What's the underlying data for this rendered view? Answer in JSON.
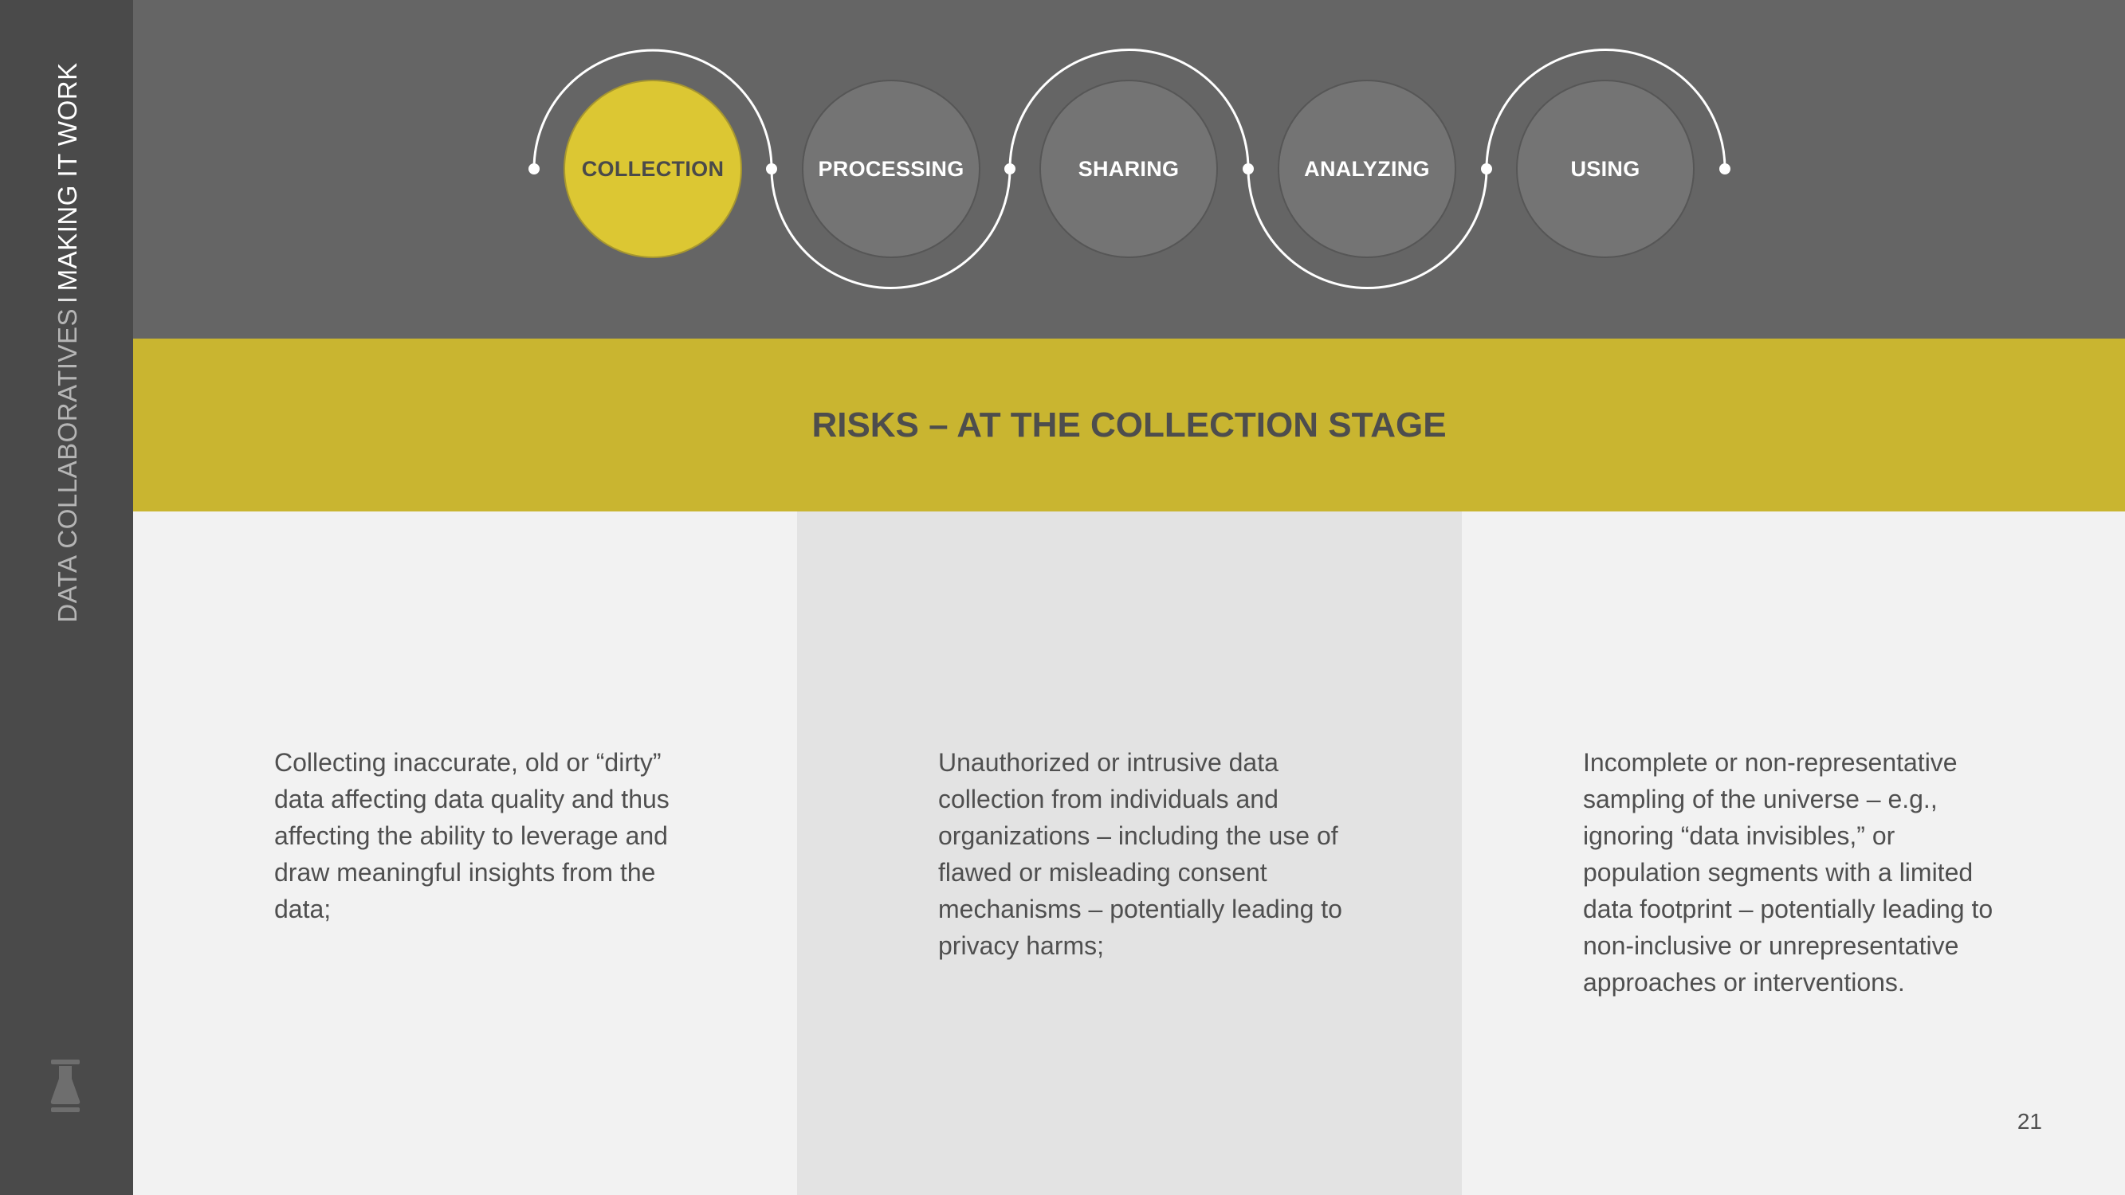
{
  "sidebar": {
    "title_part1": "DATA COLLABORATIVES",
    "separator": "I",
    "title_part2": "MAKING IT WORK",
    "logo_icon": "flask-icon"
  },
  "stages": [
    {
      "label": "COLLECTION",
      "active": true
    },
    {
      "label": "PROCESSING",
      "active": false
    },
    {
      "label": "SHARING",
      "active": false
    },
    {
      "label": "ANALYZING",
      "active": false
    },
    {
      "label": "USING",
      "active": false
    }
  ],
  "banner": {
    "title": "RISKS – AT THE COLLECTION STAGE"
  },
  "risks": [
    "Collecting inaccurate, old or “dirty” data affecting data quality and thus affecting the ability to leverage and draw meaningful insights from the data;",
    "Unauthorized or intrusive data collection from individuals and organizations – including the use of flawed or misleading consent mechanisms – potentially leading to privacy harms;",
    "Incomplete or non-representative sampling of the universe – e.g., ignoring “data invisibles,” or population segments with a limited data footprint – potentially leading to non-inclusive or unrepresentative approaches or interventions."
  ],
  "page_number": "21",
  "colors": {
    "accent": "#dcc733",
    "banner": "#c9b530",
    "sidebar": "#4a4a4a",
    "topbar": "#656565"
  }
}
